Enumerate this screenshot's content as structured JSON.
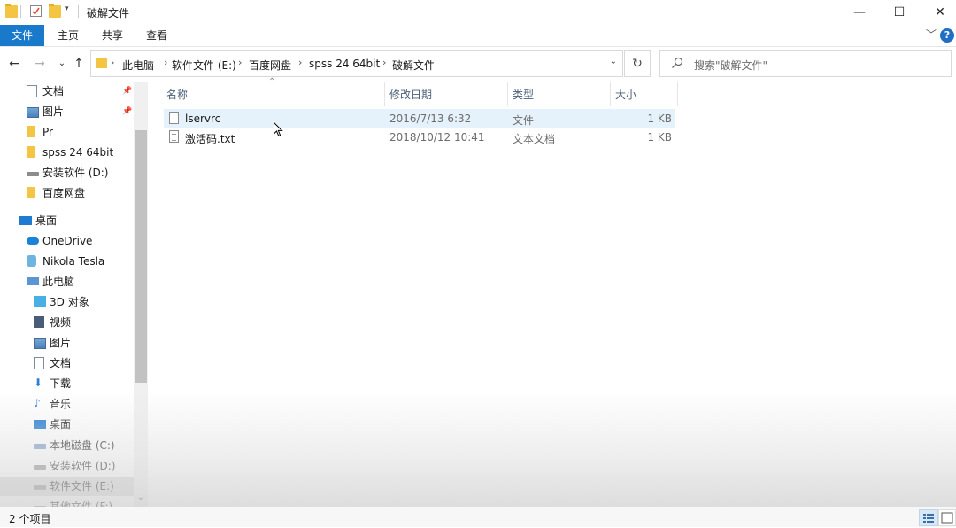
{
  "window": {
    "title": "破解文件",
    "controls": {
      "minimize": "—",
      "maximize": "☐",
      "close": "✕"
    }
  },
  "ribbon": {
    "tabs": [
      "文件",
      "主页",
      "共享",
      "查看"
    ],
    "help": "?"
  },
  "address": {
    "breadcrumbs": [
      "此电脑",
      "软件文件 (E:)",
      "百度网盘",
      "spss 24 64bit",
      "破解文件"
    ],
    "search_placeholder": "搜索\"破解文件\""
  },
  "sidebar": {
    "items": [
      {
        "label": "文档",
        "icon": "document-icon",
        "pinned": true
      },
      {
        "label": "图片",
        "icon": "picture-icon",
        "pinned": true
      },
      {
        "label": "Pr",
        "icon": "folder-icon"
      },
      {
        "label": "spss 24 64bit",
        "icon": "folder-icon"
      },
      {
        "label": "安装软件 (D:)",
        "icon": "drive-icon"
      },
      {
        "label": "百度网盘",
        "icon": "folder-icon"
      },
      {
        "label": "桌面",
        "icon": "desktop-icon"
      },
      {
        "label": "OneDrive",
        "icon": "cloud-icon"
      },
      {
        "label": "Nikola Tesla",
        "icon": "user-icon"
      },
      {
        "label": "此电脑",
        "icon": "computer-icon"
      },
      {
        "label": "3D 对象",
        "icon": "3d-objects-icon"
      },
      {
        "label": "视频",
        "icon": "video-icon"
      },
      {
        "label": "图片",
        "icon": "picture-icon"
      },
      {
        "label": "文档",
        "icon": "document-icon"
      },
      {
        "label": "下载",
        "icon": "download-icon"
      },
      {
        "label": "音乐",
        "icon": "music-icon"
      },
      {
        "label": "桌面",
        "icon": "desktop-icon"
      },
      {
        "label": "本地磁盘 (C:)",
        "icon": "system-drive-icon"
      },
      {
        "label": "安装软件 (D:)",
        "icon": "drive-icon"
      },
      {
        "label": "软件文件 (E:)",
        "icon": "drive-icon",
        "selected": true
      },
      {
        "label": "其他文件 (F:)",
        "icon": "drive-icon"
      }
    ]
  },
  "file_list": {
    "columns": [
      "名称",
      "修改日期",
      "类型",
      "大小"
    ],
    "rows": [
      {
        "name": "lservrc",
        "modified": "2016/7/13 6:32",
        "type": "文件",
        "size": "1 KB"
      },
      {
        "name": "激活码.txt",
        "modified": "2018/10/12 10:41",
        "type": "文本文档",
        "size": "1 KB"
      }
    ]
  },
  "status": {
    "text": "2 个项目"
  },
  "colors": {
    "accent": "#1979ca",
    "folder": "#f4c542",
    "selected_row": "#e5f1fb"
  }
}
